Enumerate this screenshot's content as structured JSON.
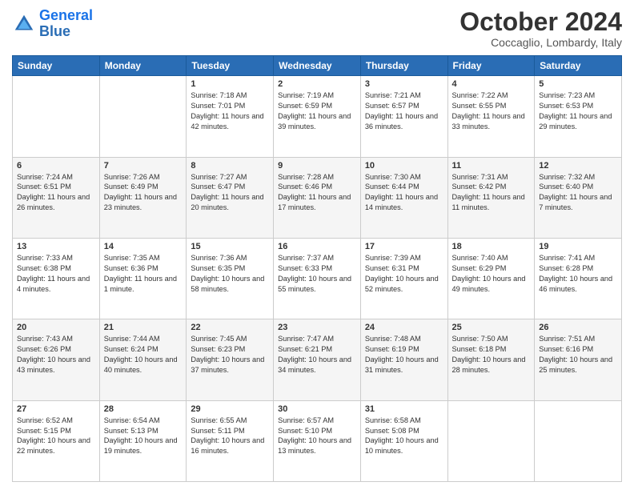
{
  "logo": {
    "line1": "General",
    "line2": "Blue"
  },
  "title": "October 2024",
  "location": "Coccaglio, Lombardy, Italy",
  "days_of_week": [
    "Sunday",
    "Monday",
    "Tuesday",
    "Wednesday",
    "Thursday",
    "Friday",
    "Saturday"
  ],
  "weeks": [
    [
      {
        "day": "",
        "info": ""
      },
      {
        "day": "",
        "info": ""
      },
      {
        "day": "1",
        "info": "Sunrise: 7:18 AM\nSunset: 7:01 PM\nDaylight: 11 hours and 42 minutes."
      },
      {
        "day": "2",
        "info": "Sunrise: 7:19 AM\nSunset: 6:59 PM\nDaylight: 11 hours and 39 minutes."
      },
      {
        "day": "3",
        "info": "Sunrise: 7:21 AM\nSunset: 6:57 PM\nDaylight: 11 hours and 36 minutes."
      },
      {
        "day": "4",
        "info": "Sunrise: 7:22 AM\nSunset: 6:55 PM\nDaylight: 11 hours and 33 minutes."
      },
      {
        "day": "5",
        "info": "Sunrise: 7:23 AM\nSunset: 6:53 PM\nDaylight: 11 hours and 29 minutes."
      }
    ],
    [
      {
        "day": "6",
        "info": "Sunrise: 7:24 AM\nSunset: 6:51 PM\nDaylight: 11 hours and 26 minutes."
      },
      {
        "day": "7",
        "info": "Sunrise: 7:26 AM\nSunset: 6:49 PM\nDaylight: 11 hours and 23 minutes."
      },
      {
        "day": "8",
        "info": "Sunrise: 7:27 AM\nSunset: 6:47 PM\nDaylight: 11 hours and 20 minutes."
      },
      {
        "day": "9",
        "info": "Sunrise: 7:28 AM\nSunset: 6:46 PM\nDaylight: 11 hours and 17 minutes."
      },
      {
        "day": "10",
        "info": "Sunrise: 7:30 AM\nSunset: 6:44 PM\nDaylight: 11 hours and 14 minutes."
      },
      {
        "day": "11",
        "info": "Sunrise: 7:31 AM\nSunset: 6:42 PM\nDaylight: 11 hours and 11 minutes."
      },
      {
        "day": "12",
        "info": "Sunrise: 7:32 AM\nSunset: 6:40 PM\nDaylight: 11 hours and 7 minutes."
      }
    ],
    [
      {
        "day": "13",
        "info": "Sunrise: 7:33 AM\nSunset: 6:38 PM\nDaylight: 11 hours and 4 minutes."
      },
      {
        "day": "14",
        "info": "Sunrise: 7:35 AM\nSunset: 6:36 PM\nDaylight: 11 hours and 1 minute."
      },
      {
        "day": "15",
        "info": "Sunrise: 7:36 AM\nSunset: 6:35 PM\nDaylight: 10 hours and 58 minutes."
      },
      {
        "day": "16",
        "info": "Sunrise: 7:37 AM\nSunset: 6:33 PM\nDaylight: 10 hours and 55 minutes."
      },
      {
        "day": "17",
        "info": "Sunrise: 7:39 AM\nSunset: 6:31 PM\nDaylight: 10 hours and 52 minutes."
      },
      {
        "day": "18",
        "info": "Sunrise: 7:40 AM\nSunset: 6:29 PM\nDaylight: 10 hours and 49 minutes."
      },
      {
        "day": "19",
        "info": "Sunrise: 7:41 AM\nSunset: 6:28 PM\nDaylight: 10 hours and 46 minutes."
      }
    ],
    [
      {
        "day": "20",
        "info": "Sunrise: 7:43 AM\nSunset: 6:26 PM\nDaylight: 10 hours and 43 minutes."
      },
      {
        "day": "21",
        "info": "Sunrise: 7:44 AM\nSunset: 6:24 PM\nDaylight: 10 hours and 40 minutes."
      },
      {
        "day": "22",
        "info": "Sunrise: 7:45 AM\nSunset: 6:23 PM\nDaylight: 10 hours and 37 minutes."
      },
      {
        "day": "23",
        "info": "Sunrise: 7:47 AM\nSunset: 6:21 PM\nDaylight: 10 hours and 34 minutes."
      },
      {
        "day": "24",
        "info": "Sunrise: 7:48 AM\nSunset: 6:19 PM\nDaylight: 10 hours and 31 minutes."
      },
      {
        "day": "25",
        "info": "Sunrise: 7:50 AM\nSunset: 6:18 PM\nDaylight: 10 hours and 28 minutes."
      },
      {
        "day": "26",
        "info": "Sunrise: 7:51 AM\nSunset: 6:16 PM\nDaylight: 10 hours and 25 minutes."
      }
    ],
    [
      {
        "day": "27",
        "info": "Sunrise: 6:52 AM\nSunset: 5:15 PM\nDaylight: 10 hours and 22 minutes."
      },
      {
        "day": "28",
        "info": "Sunrise: 6:54 AM\nSunset: 5:13 PM\nDaylight: 10 hours and 19 minutes."
      },
      {
        "day": "29",
        "info": "Sunrise: 6:55 AM\nSunset: 5:11 PM\nDaylight: 10 hours and 16 minutes."
      },
      {
        "day": "30",
        "info": "Sunrise: 6:57 AM\nSunset: 5:10 PM\nDaylight: 10 hours and 13 minutes."
      },
      {
        "day": "31",
        "info": "Sunrise: 6:58 AM\nSunset: 5:08 PM\nDaylight: 10 hours and 10 minutes."
      },
      {
        "day": "",
        "info": ""
      },
      {
        "day": "",
        "info": ""
      }
    ]
  ]
}
